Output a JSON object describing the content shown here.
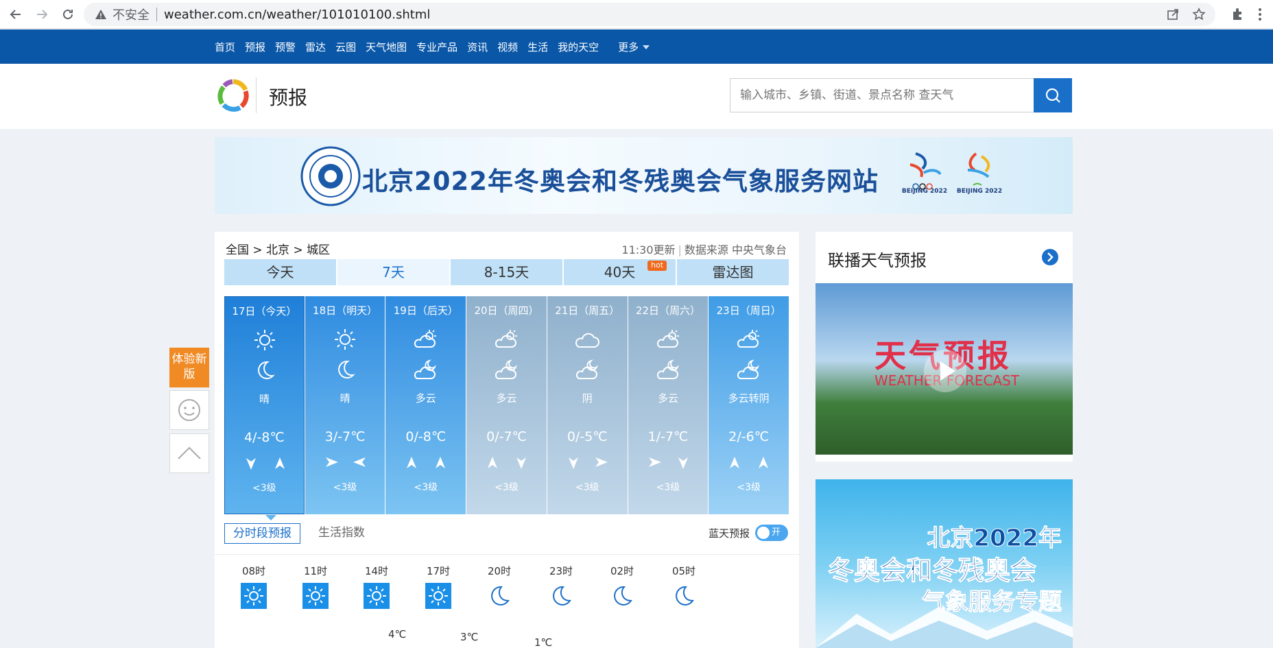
{
  "browser": {
    "insecure_label": "不安全",
    "url": "weather.com.cn/weather/101010100.shtml"
  },
  "topnav": {
    "items": [
      "首页",
      "预报",
      "预警",
      "雷达",
      "云图",
      "天气地图",
      "专业产品",
      "资讯",
      "视频",
      "生活",
      "我的天空"
    ],
    "more": "更多"
  },
  "header": {
    "title": "预报",
    "search_placeholder": "输入城市、乡镇、街道、景点名称 查天气"
  },
  "banner": {
    "text": "北京2022年冬奥会和冬残奥会气象服务网站",
    "logo_caption_1": "BEIJING 2022",
    "logo_caption_2": "BEIJING 2022"
  },
  "float": {
    "try_new": "体验新版"
  },
  "forecast": {
    "breadcrumb": "全国 > 北京 > 城区",
    "update_time": "11:30更新",
    "source": "数据来源 中央气象台",
    "tabs": [
      "今天",
      "7天",
      "8-15天",
      "40天",
      "雷达图"
    ],
    "hot_badge": "hot",
    "days": [
      {
        "date": "17日（今天）",
        "desc": "晴",
        "temp": "4/-8℃",
        "level": "<3级"
      },
      {
        "date": "18日（明天）",
        "desc": "晴",
        "temp": "3/-7℃",
        "level": "<3级"
      },
      {
        "date": "19日（后天）",
        "desc": "多云",
        "temp": "0/-8℃",
        "level": "<3级"
      },
      {
        "date": "20日（周四）",
        "desc": "多云",
        "temp": "0/-7℃",
        "level": "<3级"
      },
      {
        "date": "21日（周五）",
        "desc": "阴",
        "temp": "0/-5℃",
        "level": "<3级"
      },
      {
        "date": "22日（周六）",
        "desc": "多云",
        "temp": "1/-7℃",
        "level": "<3级"
      },
      {
        "date": "23日（周日）",
        "desc": "多云转阴",
        "temp": "2/-6℃",
        "level": "<3级"
      }
    ],
    "subtabs": [
      "分时段预报",
      "生活指数"
    ],
    "bluesky_label": "蓝天预报",
    "toggle_label": "开",
    "hours": [
      "08时",
      "11时",
      "14时",
      "17时",
      "20时",
      "23时",
      "02时",
      "05时"
    ],
    "hour_temps": [
      "4℃",
      "3℃",
      "1℃"
    ]
  },
  "live": {
    "title": "联播天气预报",
    "video_title": "天气预报",
    "video_sub": "WEATHER FORECAST"
  },
  "promo": {
    "line1": "北京2022年",
    "line2": "冬奥会和冬残奥会",
    "line3": "气象服务专题"
  }
}
